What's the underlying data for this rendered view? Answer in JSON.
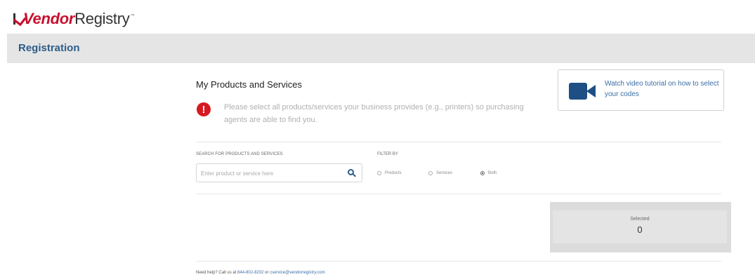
{
  "header": {
    "logo_text_1": "Vendor",
    "logo_text_2": "Registry",
    "logo_tm": "™"
  },
  "registration_bar": {
    "title": "Registration"
  },
  "main": {
    "section_title": "My Products and Services",
    "alert_text": "Please select all products/services your business provides (e.g., printers) so purchasing agents are able to find you.",
    "video_link": "Watch video tutorial on how to select your codes"
  },
  "search": {
    "label": "SEARCH FOR PRODUCTS AND SERVICES",
    "placeholder": "Enter product or service here",
    "value": ""
  },
  "filter": {
    "label": "FILTER BY",
    "options": [
      {
        "label": "Products",
        "checked": false
      },
      {
        "label": "Services",
        "checked": false
      },
      {
        "label": "Both",
        "checked": true
      }
    ]
  },
  "selected": {
    "label": "Selected",
    "count": "0"
  },
  "footer": {
    "prefix": "Need help? Call us at ",
    "phone": "844-802-8202",
    "middle": " or ",
    "email": "cservice@vendorregistry.com"
  },
  "colors": {
    "brand_red": "#c8102e",
    "link_blue": "#3a6ea5",
    "title_blue": "#2d5d8a",
    "alert_red": "#d71921"
  }
}
